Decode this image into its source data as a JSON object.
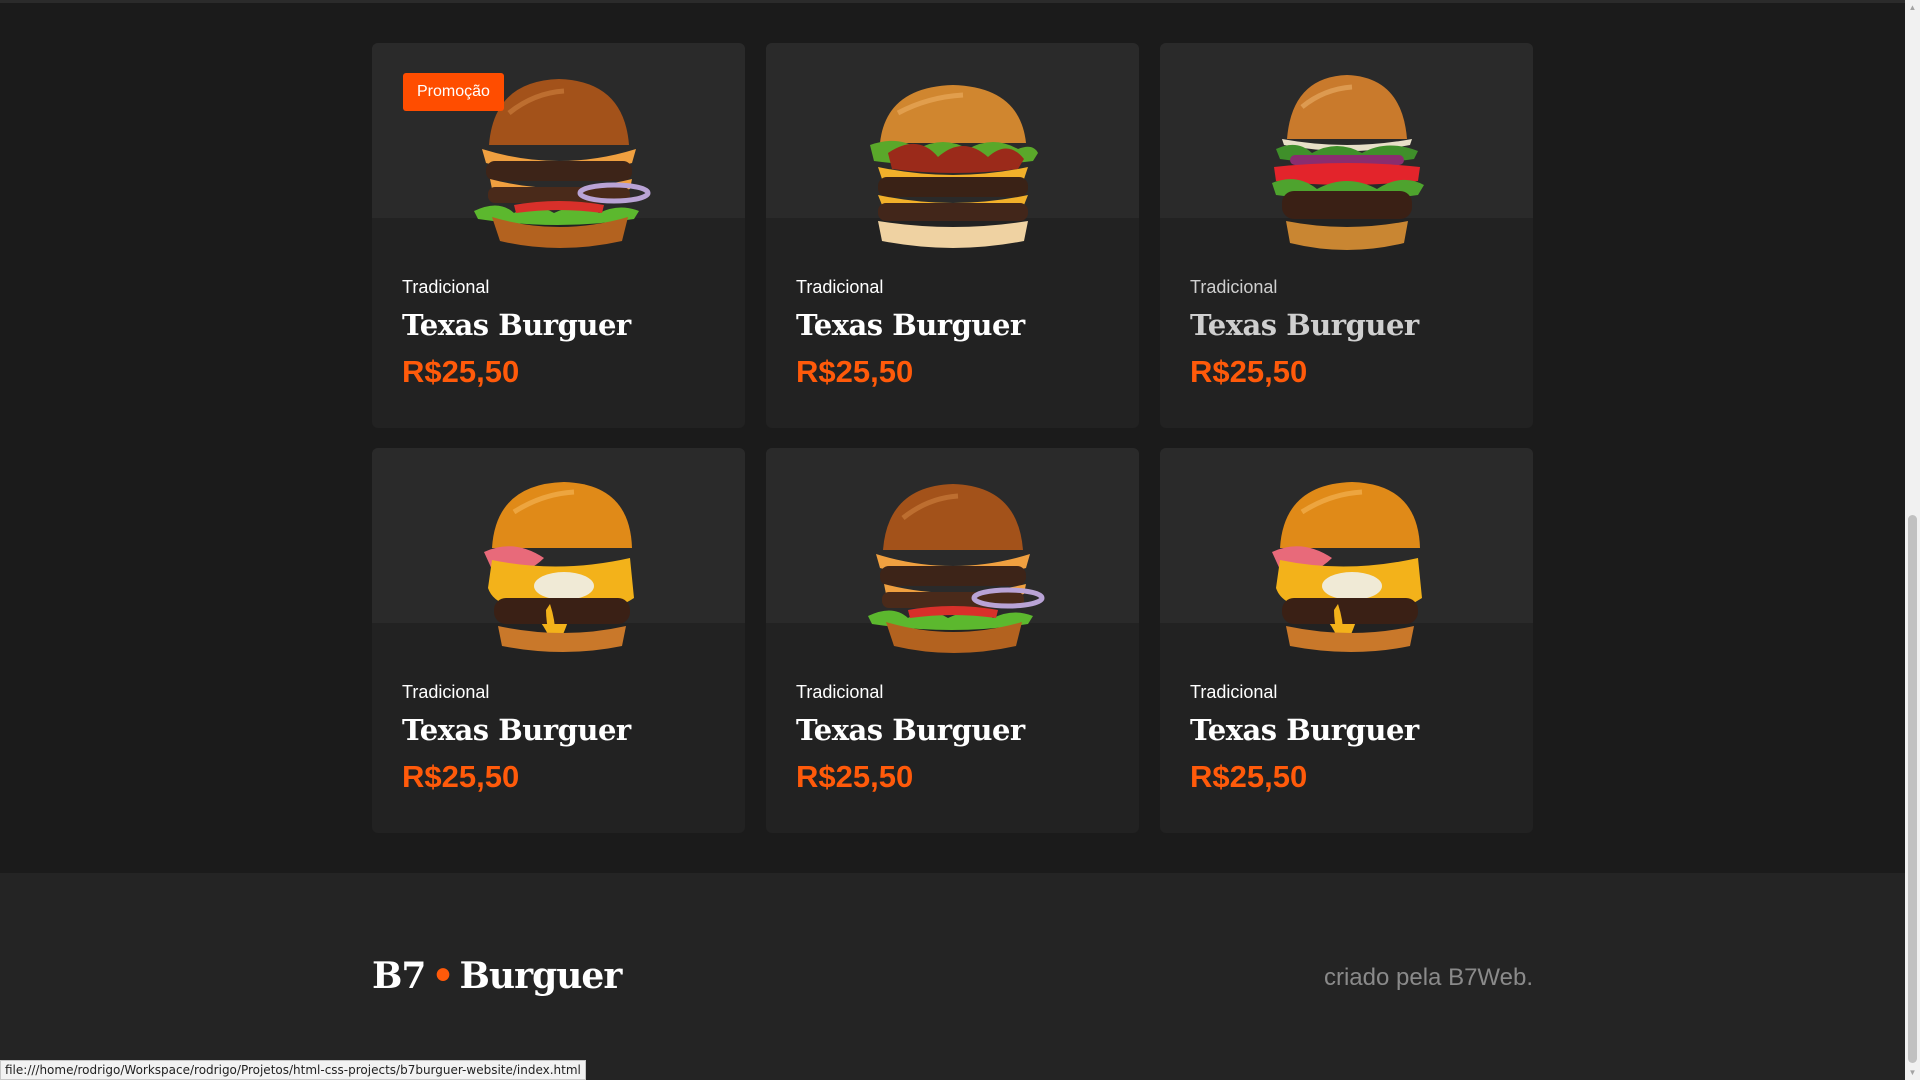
{
  "products": [
    {
      "badge": "Promoção",
      "category": "Tradicional",
      "name": "Texas Burguer",
      "price": "R$25,50",
      "image": "burger-cheese-onion"
    },
    {
      "badge": null,
      "category": "Tradicional",
      "name": "Texas Burguer",
      "price": "R$25,50",
      "image": "burger-bacon-double"
    },
    {
      "badge": null,
      "category": "Tradicional",
      "name": "Texas Burguer",
      "price": "R$25,50",
      "image": "burger-tomato-lettuce"
    },
    {
      "badge": null,
      "category": "Tradicional",
      "name": "Texas Burguer",
      "price": "R$25,50",
      "image": "burger-ham-egg"
    },
    {
      "badge": null,
      "category": "Tradicional",
      "name": "Texas Burguer",
      "price": "R$25,50",
      "image": "burger-cheese-onion"
    },
    {
      "badge": null,
      "category": "Tradicional",
      "name": "Texas Burguer",
      "price": "R$25,50",
      "image": "burger-ham-egg"
    }
  ],
  "footer": {
    "logo_left": "B7",
    "logo_dot": "•",
    "logo_right": "Burguer",
    "credit": "criado pela B7Web."
  },
  "status_bar": {
    "url": "file:///home/rodrigo/Workspace/rodrigo/Projetos/html-css-projects/b7burguer-website/index.html"
  },
  "colors": {
    "accent": "#ff5a0a",
    "badge": "#ff4d00",
    "card": "#222222",
    "background": "#1b1b1b"
  }
}
